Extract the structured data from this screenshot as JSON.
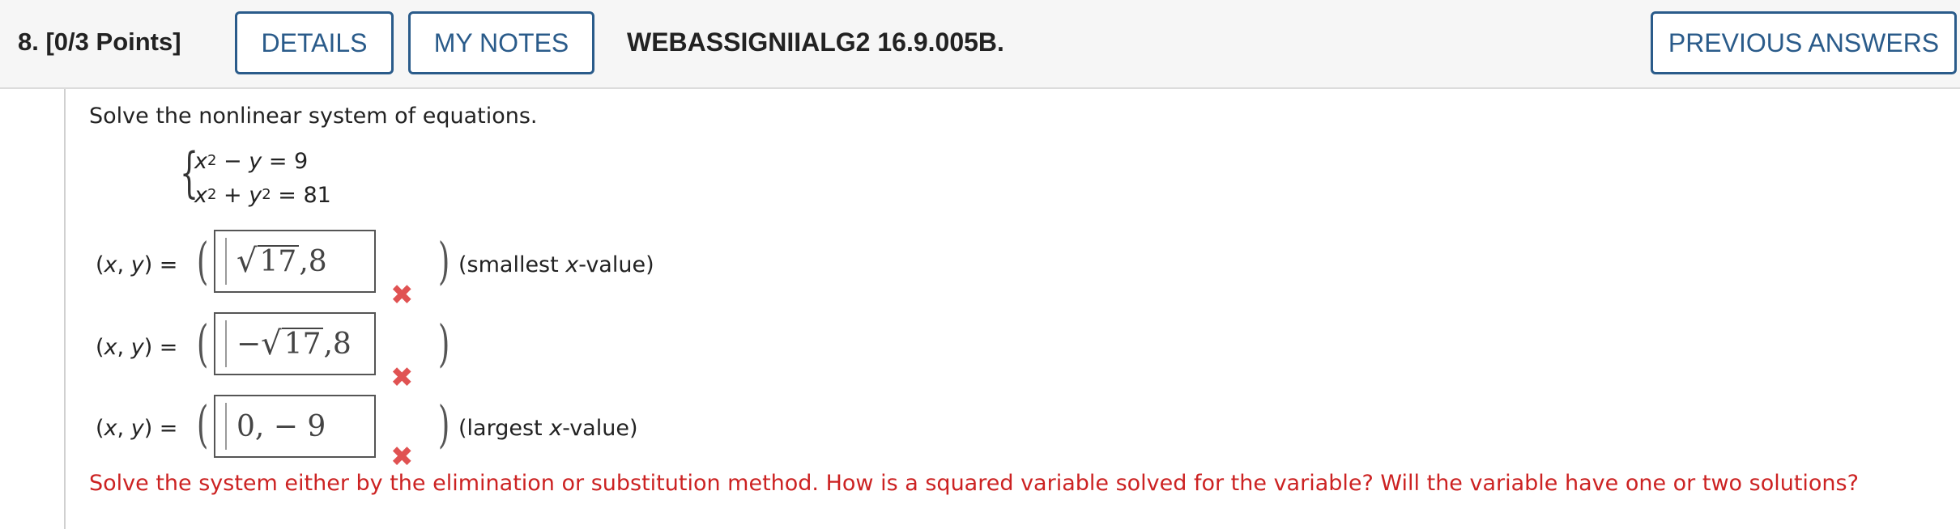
{
  "header": {
    "question_number": "8.",
    "points": "[0/3 Points]",
    "details_label": "DETAILS",
    "my_notes_label": "MY NOTES",
    "question_id": "WEBASSIGNIIALG2 16.9.005B.",
    "previous_answers_label": "PREVIOUS ANSWERS"
  },
  "problem": {
    "prompt": "Solve the nonlinear system of equations.",
    "equations": [
      {
        "lhs_var1": "x",
        "lhs_exp1": "2",
        "op": "−",
        "lhs_var2": "y",
        "lhs_exp2": "",
        "rhs": "= 9"
      },
      {
        "lhs_var1": "x",
        "lhs_exp1": "2",
        "op": "+",
        "lhs_var2": "y",
        "lhs_exp2": "2",
        "rhs": "= 81"
      }
    ]
  },
  "answers": {
    "pair_label_prefix": "(",
    "pair_label_x": "x",
    "pair_label_sep": ", ",
    "pair_label_y": "y",
    "pair_label_suffix": ") =",
    "rows": [
      {
        "sign": "",
        "radicand": "17",
        "rest": ",8",
        "plain": "",
        "note_prefix": "(smallest ",
        "note_var": "x",
        "note_suffix": "-value)",
        "status": "incorrect"
      },
      {
        "sign": "−",
        "radicand": "17",
        "rest": ",8",
        "plain": "",
        "note_prefix": "",
        "note_var": "",
        "note_suffix": "",
        "status": "incorrect"
      },
      {
        "sign": "",
        "radicand": "",
        "rest": "",
        "plain": "0, − 9",
        "note_prefix": "(largest ",
        "note_var": "x",
        "note_suffix": "-value)",
        "status": "incorrect"
      }
    ],
    "incorrect_icon": "close-x-icon",
    "incorrect_color": "#e05252"
  },
  "hint": "Solve the system either by the elimination or substitution method. How is a squared variable solved for the variable? Will the variable have one or two solutions?",
  "colors": {
    "accent": "#2a5b8a",
    "hint": "#cc2222",
    "header_bg": "#f6f6f6"
  }
}
